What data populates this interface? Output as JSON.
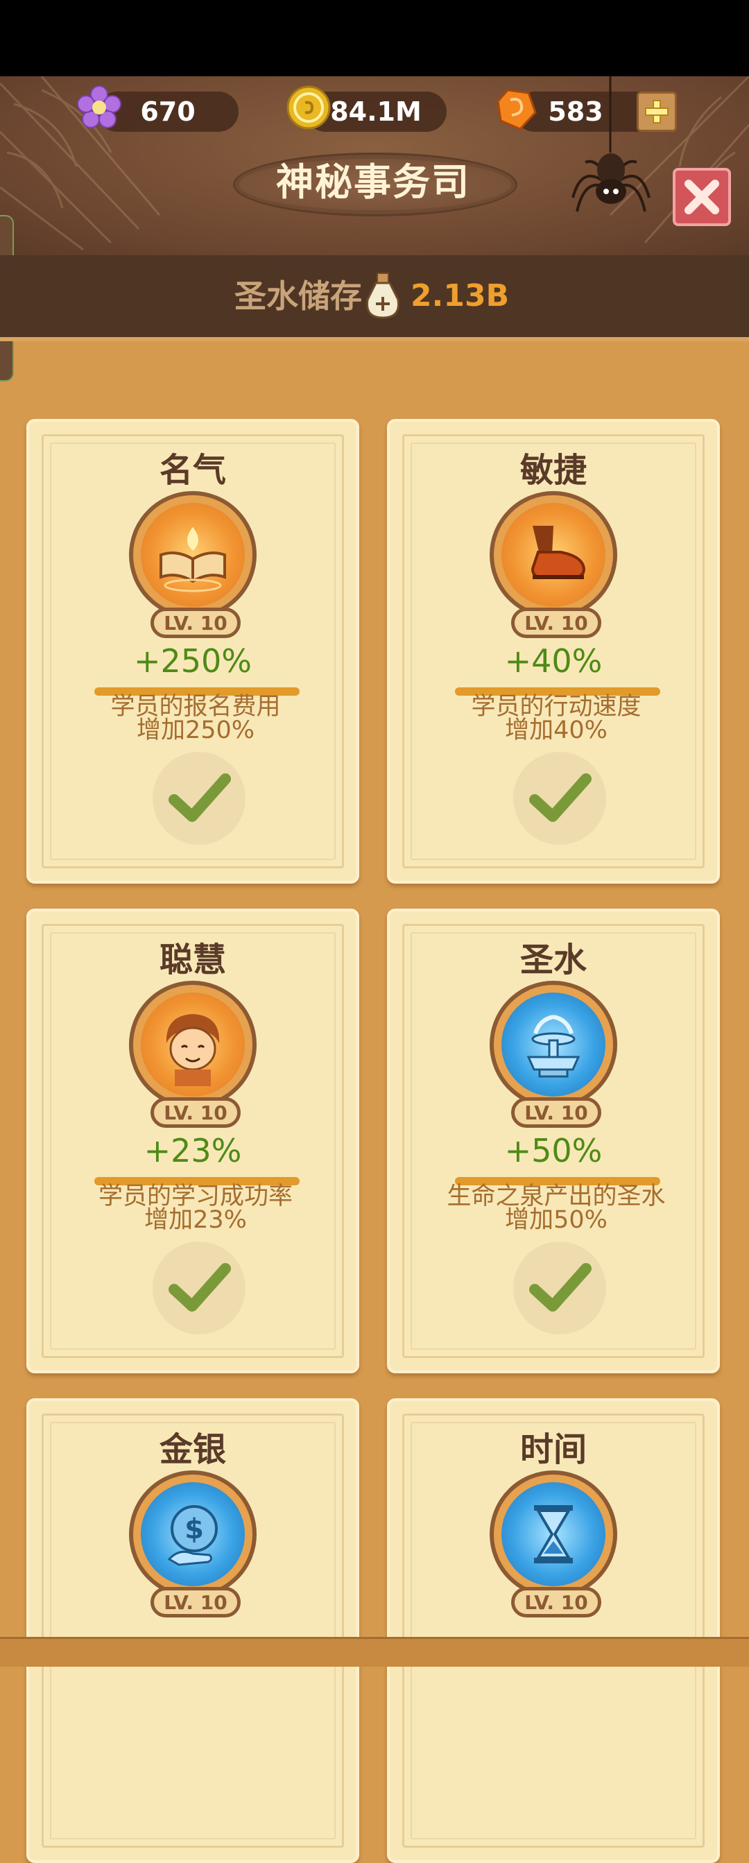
{
  "resources": {
    "flower": {
      "value": "670",
      "icon": "purple-flower-icon"
    },
    "coin": {
      "value": "84.1M",
      "icon": "gold-coin-icon"
    },
    "gem": {
      "value": "583",
      "icon": "orange-gem-icon"
    }
  },
  "header": {
    "title": "神秘事务司"
  },
  "storage": {
    "label": "圣水储存",
    "value": "2.13B"
  },
  "cards": [
    {
      "title": "名气",
      "level": "LV. 10",
      "bonus": "+250%",
      "desc1": "学员的报名费用",
      "desc2": "增加250%",
      "icon": "glowing-book-icon",
      "face": "orange"
    },
    {
      "title": "敏捷",
      "level": "LV. 10",
      "bonus": "+40%",
      "desc1": "学员的行动速度",
      "desc2": "增加40%",
      "icon": "running-shoe-icon",
      "face": "orange"
    },
    {
      "title": "聪慧",
      "level": "LV. 10",
      "bonus": "+23%",
      "desc1": "学员的学习成功率",
      "desc2": "增加23%",
      "icon": "student-face-icon",
      "face": "orange"
    },
    {
      "title": "圣水",
      "level": "LV. 10",
      "bonus": "+50%",
      "desc1": "生命之泉产出的圣水",
      "desc2": "增加50%",
      "icon": "fountain-icon",
      "face": "blue"
    },
    {
      "title": "金银",
      "level": "LV. 10",
      "bonus": "",
      "desc1": "",
      "desc2": "",
      "icon": "dollar-coin-icon",
      "face": "blue"
    },
    {
      "title": "时间",
      "level": "LV. 10",
      "bonus": "",
      "desc1": "",
      "desc2": "",
      "icon": "hourglass-icon",
      "face": "blue"
    }
  ],
  "colors": {
    "header_bg": "#6c4630",
    "card_bg": "#f8e8b8",
    "bonus_green": "#4f8a16",
    "close_red": "#d2555a",
    "storage_value": "#ef9f2d"
  }
}
